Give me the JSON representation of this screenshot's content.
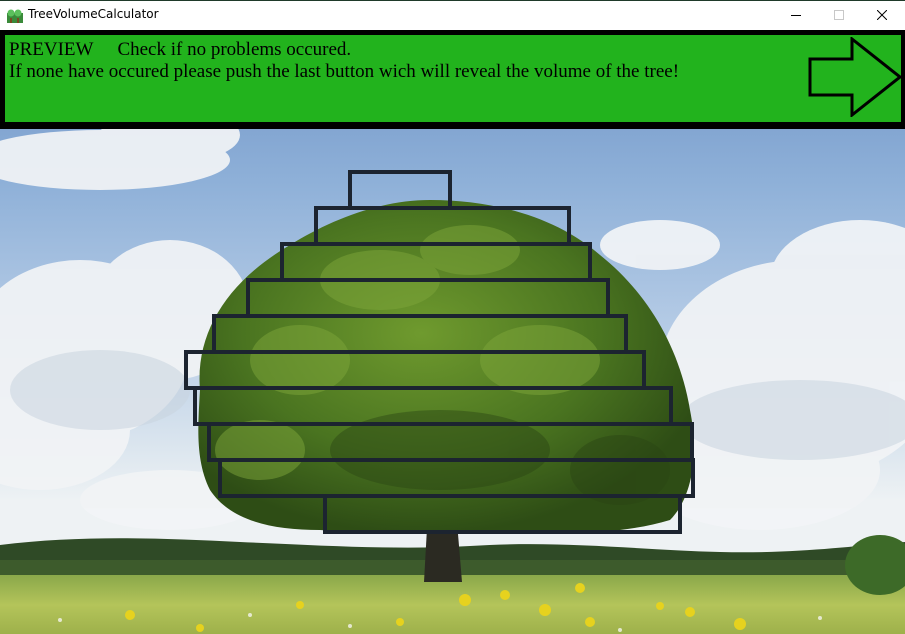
{
  "window": {
    "title": "TreeVolumeCalculator"
  },
  "banner": {
    "mode_label": "PREVIEW",
    "line1": "Check if no problems occured.",
    "line2": "If none have occured please push the last button wich will reveal the volume of the tree!",
    "next_button_icon": "right-arrow-icon"
  },
  "colors": {
    "banner_green": "#22b31d",
    "outline_black": "#000000",
    "box_stroke": "#1c2430"
  },
  "icons": {
    "app": "tree-app-icon",
    "minimize": "minimize-icon",
    "maximize": "maximize-icon",
    "close": "close-icon"
  }
}
